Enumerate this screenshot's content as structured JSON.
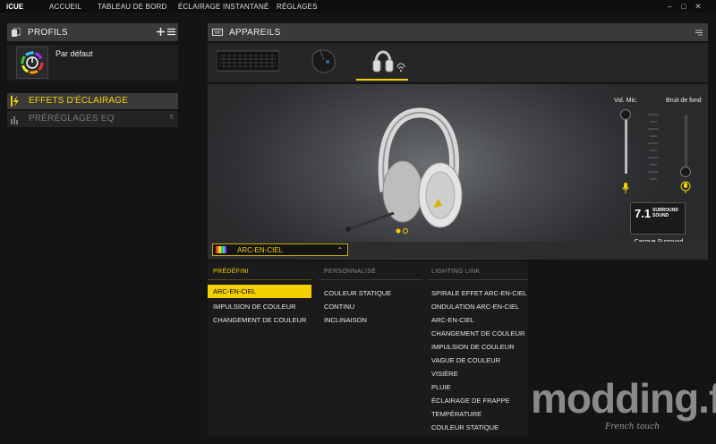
{
  "titlebar": {
    "app_name": "iCUE",
    "nav": [
      "ACCUEIL",
      "TABLEAU DE BORD",
      "ÉCLAIRAGE INSTANTANÉ",
      "RÉGLAGES"
    ]
  },
  "profiles": {
    "header": "PROFILS",
    "current": "Par défaut"
  },
  "sidebar": {
    "items": [
      {
        "label": "EFFETS D'ÉCLAIRAGE",
        "active": true
      },
      {
        "label": "PRÉRÉGLAGES EQ",
        "count": "5",
        "active": false
      }
    ]
  },
  "devices": {
    "header": "APPAREILS",
    "list": [
      "keyboard",
      "mouse",
      "headset"
    ],
    "selected": "headset"
  },
  "audio": {
    "mic_label": "Vol. Mic.",
    "noise_label": "Bruit de fond",
    "surround_big": "7.1",
    "surround_small": [
      "SURROUND",
      "SOUND"
    ],
    "surround_caption": "Casque Surround"
  },
  "effect_select": {
    "value": "ARC-EN-CIEL"
  },
  "dropdown": {
    "columns": [
      {
        "header": "PRÉDÉFINI",
        "items": [
          "ARC-EN-CIEL",
          "IMPULSION DE COULEUR",
          "CHANGEMENT DE COULEUR"
        ]
      },
      {
        "header": "PERSONNALISÉ",
        "items": [
          "COULEUR STATIQUE",
          "CONTINU",
          "INCLINAISON"
        ]
      },
      {
        "header": "LIGHTING LINK",
        "items": [
          "SPIRALE EFFET ARC-EN-CIEL",
          "ONDULATION ARC-EN-CIEL",
          "ARC-EN-CIEL",
          "CHANGEMENT DE COULEUR",
          "IMPULSION DE COULEUR",
          "VAGUE DE COULEUR",
          "VISIÈRE",
          "PLUIE",
          "ÉCLAIRAGE DE FRAPPE",
          "TEMPÉRATURE",
          "COULEUR STATIQUE"
        ]
      }
    ],
    "selected": "ARC-EN-CIEL"
  },
  "watermark": {
    "main": "modding.fr",
    "sub": "French touch"
  },
  "colors": {
    "accent": "#f5d000",
    "background": "#141414",
    "panel": "#3a3a3a"
  }
}
